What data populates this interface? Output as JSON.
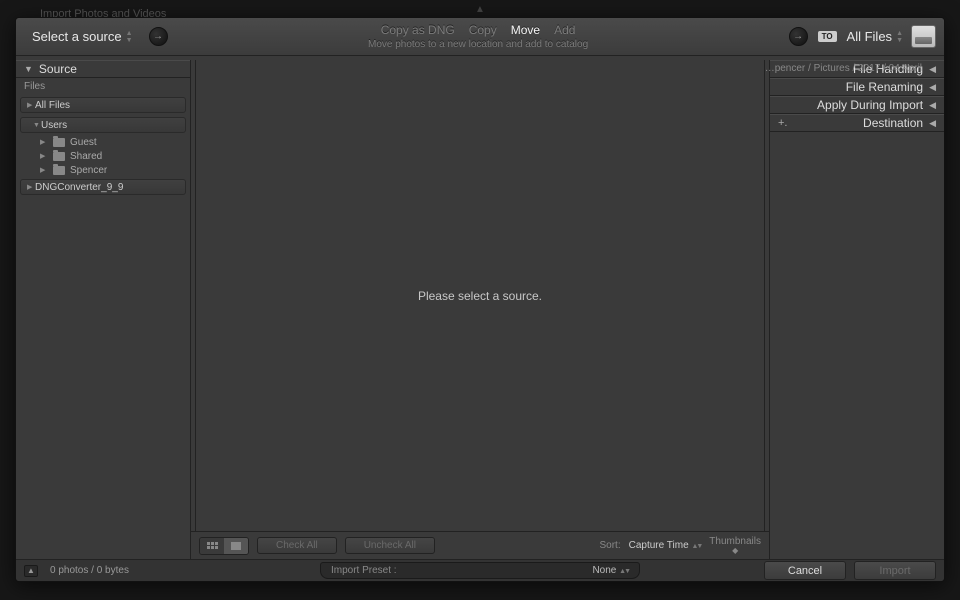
{
  "behind_title": "Import Photos and Videos",
  "header": {
    "source_label": "Select a source",
    "modes": {
      "copy_dng": "Copy as DNG",
      "copy": "Copy",
      "move": "Move",
      "add": "Add"
    },
    "subtitle": "Move photos to a new location and add to catalog",
    "to_badge": "TO",
    "dest_label": "All Files",
    "dest_path": "…pencer / Pictures / 2017 / 04 April"
  },
  "left": {
    "title": "Source",
    "files_label": "Files",
    "all_files": "All Files",
    "users": "Users",
    "user_items": [
      "Guest",
      "Shared",
      "Spencer"
    ],
    "dng": "DNGConverter_9_9"
  },
  "right": {
    "panels": [
      "File Handling",
      "File Renaming",
      "Apply During Import",
      "Destination"
    ]
  },
  "main": {
    "placeholder": "Please select a source."
  },
  "toolbar": {
    "check_all": "Check All",
    "uncheck_all": "Uncheck All",
    "sort_label": "Sort:",
    "sort_value": "Capture Time",
    "thumbs_label": "Thumbnails"
  },
  "status": {
    "count": "0 photos / 0 bytes",
    "preset_label": "Import Preset :",
    "preset_value": "None"
  },
  "actions": {
    "cancel": "Cancel",
    "import": "Import"
  }
}
